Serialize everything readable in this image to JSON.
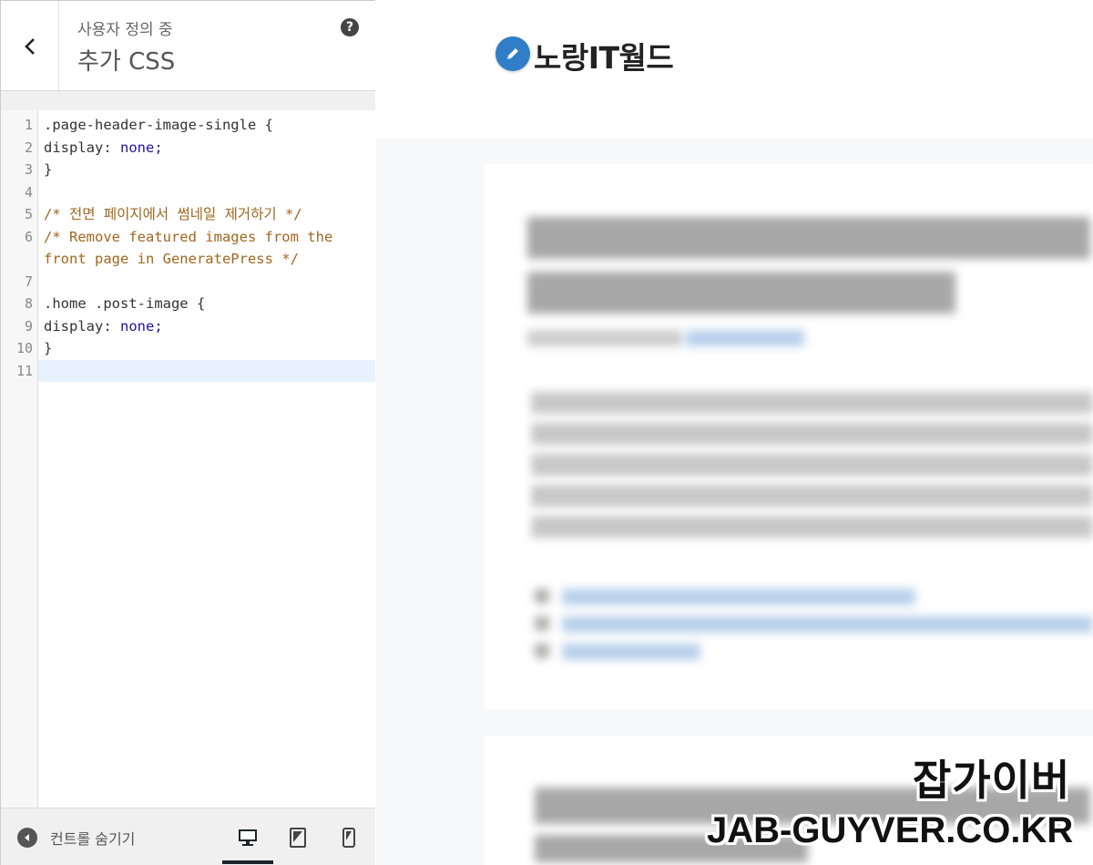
{
  "panel": {
    "header": {
      "subtitle": "사용자 정의 중",
      "title": "추가 CSS",
      "help_icon": "?"
    },
    "editor": {
      "lines": [
        {
          "number": "1",
          "text": ".page-header-image-single {"
        },
        {
          "number": "2",
          "prop": "display",
          "value": "none;"
        },
        {
          "number": "3",
          "text": "}"
        },
        {
          "number": "4",
          "text": ""
        },
        {
          "number": "5",
          "comment": "/* 전면 페이지에서 썸네일 제거하기 */"
        },
        {
          "number": "6",
          "comment": "/* Remove featured images from the"
        },
        {
          "number": "",
          "comment": "front page in GeneratePress */"
        },
        {
          "number": "7",
          "text": ""
        },
        {
          "number": "8",
          "text": ".home .post-image {"
        },
        {
          "number": "9",
          "prop": "display",
          "value": "none;"
        },
        {
          "number": "10",
          "text": "}"
        },
        {
          "number": "11",
          "text": ""
        }
      ]
    },
    "footer": {
      "hide_controls_label": "컨트롤 숨기기",
      "devices": [
        "desktop-icon",
        "tablet-icon",
        "mobile-icon"
      ],
      "active_device": "desktop"
    }
  },
  "preview": {
    "site_title": "노랑IT월드",
    "logo_icon": "pencil-icon",
    "logo_color": "#2f7ec7"
  },
  "watermark": {
    "korean": "잡가이버",
    "english": "JAB-GUYVER.CO.KR"
  }
}
